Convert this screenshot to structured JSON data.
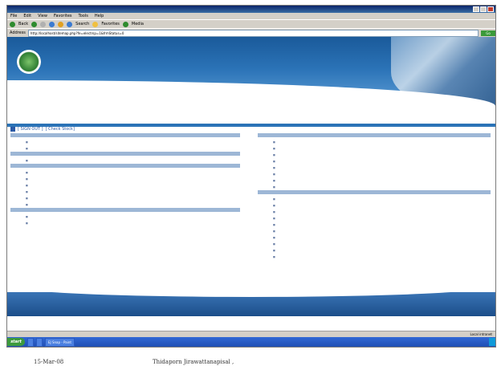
{
  "browser": {
    "title": "",
    "menu": [
      "File",
      "Edit",
      "View",
      "Favorites",
      "Tools",
      "Help"
    ],
    "toolbar": [
      "Back",
      "Search",
      "Favorites",
      "Media"
    ],
    "address_label": "Address",
    "address_value": "http://localhost/sitemap.php?fe=electrsp=1&frmStatus=0",
    "go_label": "Go"
  },
  "banner": {
    "user_name": "",
    "user_detail": ""
  },
  "auth": {
    "sign_out": "[ SIGN OUT ]",
    "check_stock": "[ Check Stock]"
  },
  "status": {
    "zone": "Local intranet"
  },
  "taskbar": {
    "start": "start",
    "tasks": [
      "",
      "",
      "EJ Snap - Paint"
    ],
    "time": ""
  },
  "caption": {
    "date": "15-Mar-08",
    "author": "Thidaporn Jirawattanapisal ,"
  }
}
